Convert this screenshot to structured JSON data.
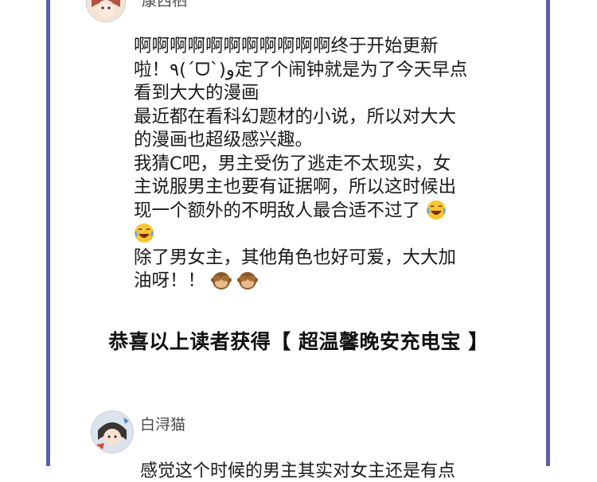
{
  "comment_top": {
    "username": "康西栖",
    "lines": [
      "啊啊啊啊啊啊啊啊啊啊啊终于开始更新",
      "啦！٩(ˊᗜˋ)و定了个闹钟就是为了今天早点",
      "看到大大的漫画",
      "最近都在看科幻题材的小说，所以对大大",
      "的漫画也超级感兴趣。",
      "我猜C吧，男主受伤了逃走不太现实，女",
      "主说服男主也要有证据啊，所以这时候出",
      "现一个额外的不明敌人最合适不过了",
      "",
      "除了男女主，其他角色也好可爱，大大加",
      "油呀！！"
    ],
    "emoji_icons": [
      "laughing-emoji-icon",
      "see-no-evil-monkey-icon"
    ]
  },
  "announcement": "恭喜以上读者获得【 超温馨晚安充电宝 】",
  "comment_bottom": {
    "username": "白浔猫",
    "preview_text": "感觉这个时候的男主其实对女主还是有点"
  },
  "colors": {
    "frame": "#5a5fa8",
    "text": "#1a1a1a",
    "username": "#4b4b4b"
  }
}
